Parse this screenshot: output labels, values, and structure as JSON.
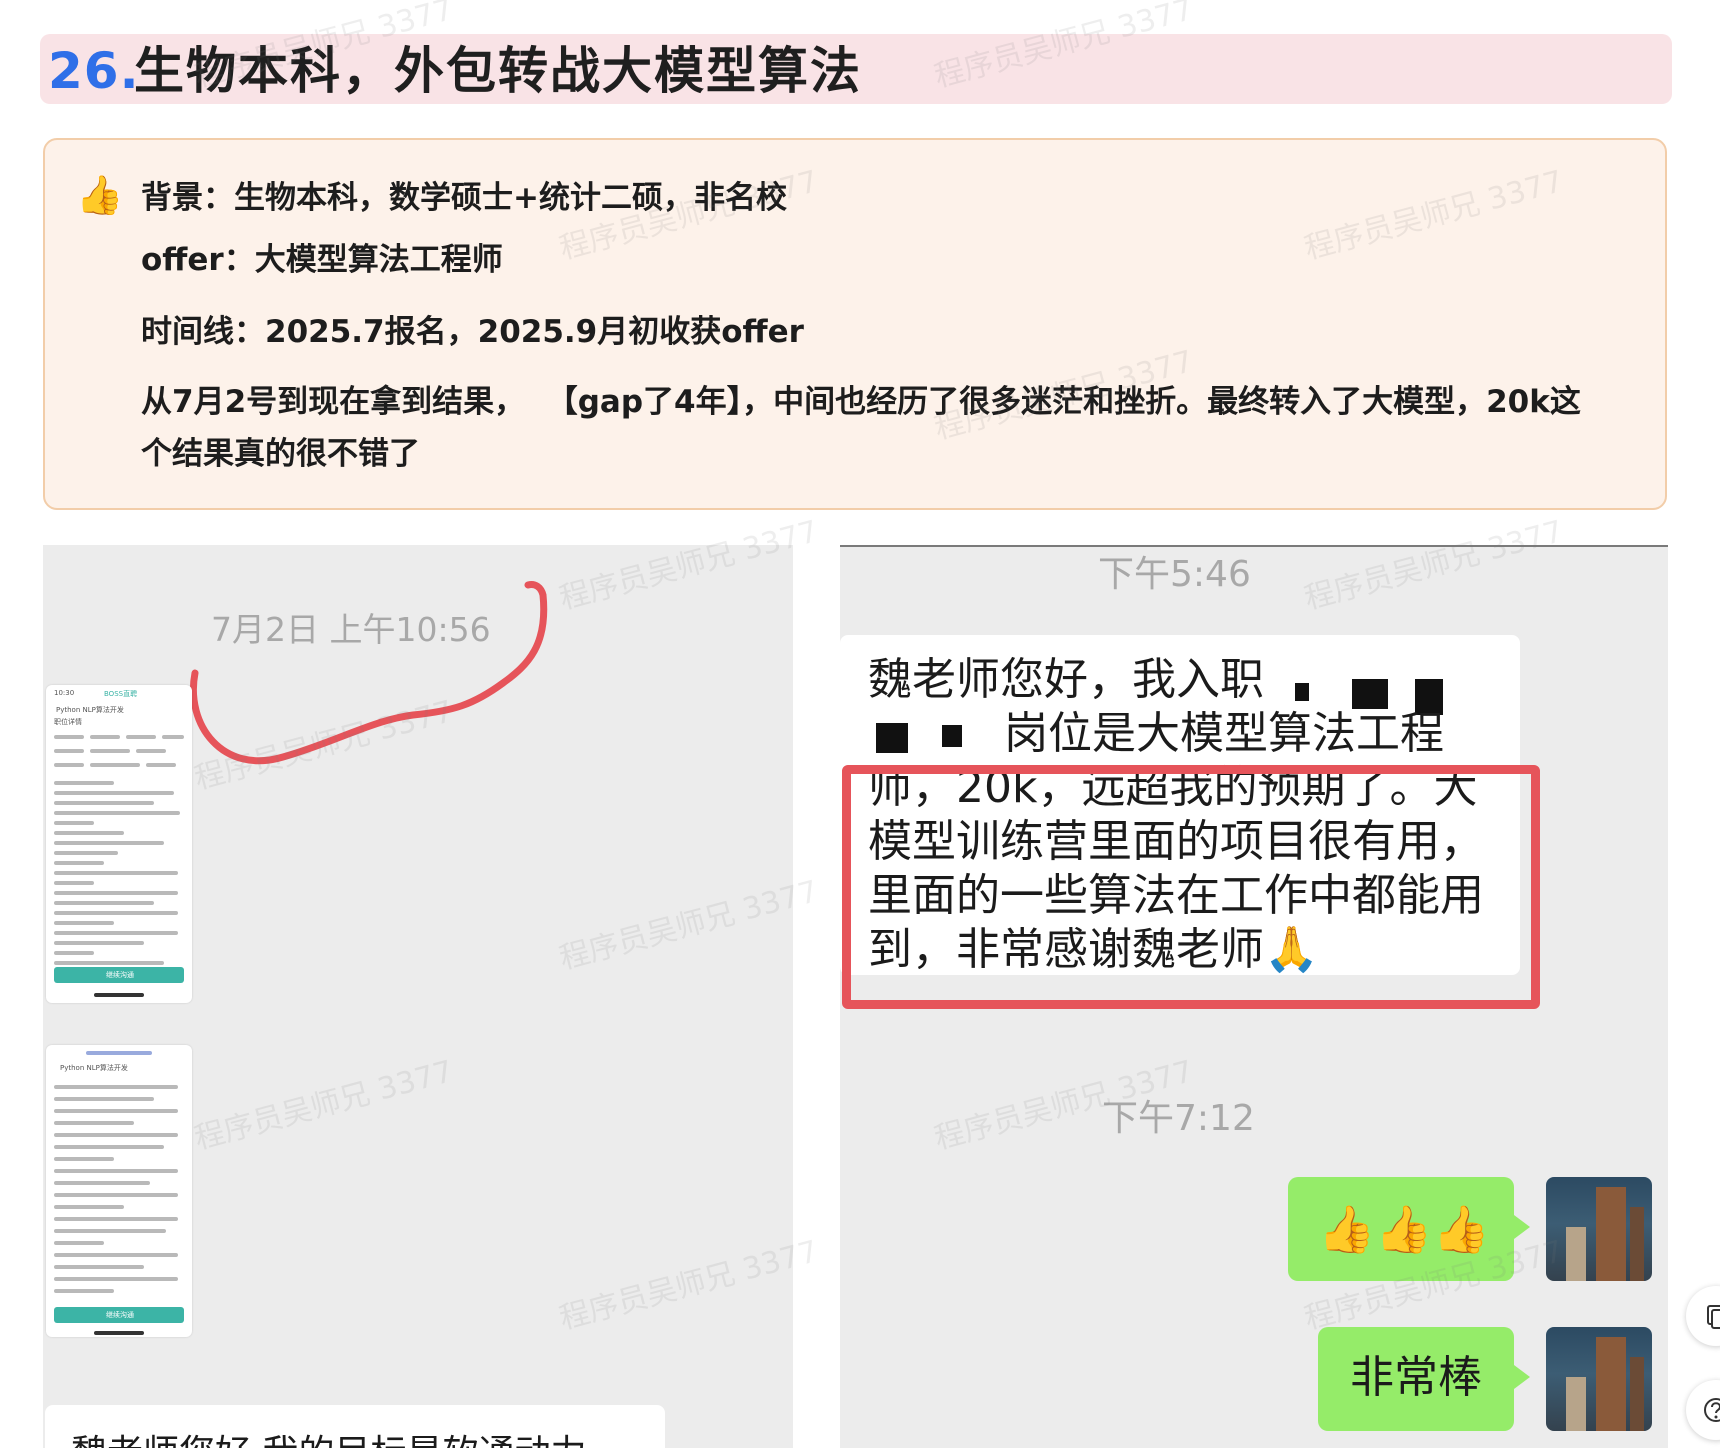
{
  "heading": {
    "number": "26.",
    "title": "生物本科，外包转战大模型算法"
  },
  "callout": {
    "icon": "thumbs-up-icon",
    "emoji": "👍",
    "lines": [
      "背景：生物本科，数学硕士+统计二硕，非名校",
      "offer：大模型算法工程师",
      "时间线：2025.7报名，2025.9月初收获offer",
      "从7月2号到现在拿到结果，  【gap了4年】，中间也经历了很多迷茫和挫折。最终转入了大模型，20k这",
      "个结果真的很不错了"
    ]
  },
  "left_chat": {
    "timestamp": "7月2日 上午10:56",
    "phone1": {
      "status_time": "10:30",
      "app": "BOSS直聘",
      "job_title": "Python NLP算法开发",
      "section": "职位详情",
      "button": "继续沟通"
    },
    "phone2": {
      "job_title": "Python NLP算法开发",
      "button": "继续沟通"
    },
    "bottom_message": "魏老师您好 我的目标是软通动力"
  },
  "right_chat": {
    "time1": "下午5:46",
    "message_lines": [
      "魏老师您好，我入职",
      "岗位是大模型算法工程",
      "师，20k，远超我的预期了。大",
      "模型训练营里面的项目很有用，",
      "里面的一些算法在工作中都能用",
      "到，非常感谢魏老师🙏"
    ],
    "time2": "下午7:12",
    "reply1": "👍👍👍",
    "reply2": "非常棒"
  },
  "watermark": "程序员吴师兄 3377",
  "colors": {
    "heading_bg": "#f9e3e6",
    "heading_number": "#2f6fe8",
    "callout_bg": "#fdf2ea",
    "callout_border": "#f2cda9",
    "annotation_red": "#e6545a",
    "wechat_green": "#95ec69"
  }
}
